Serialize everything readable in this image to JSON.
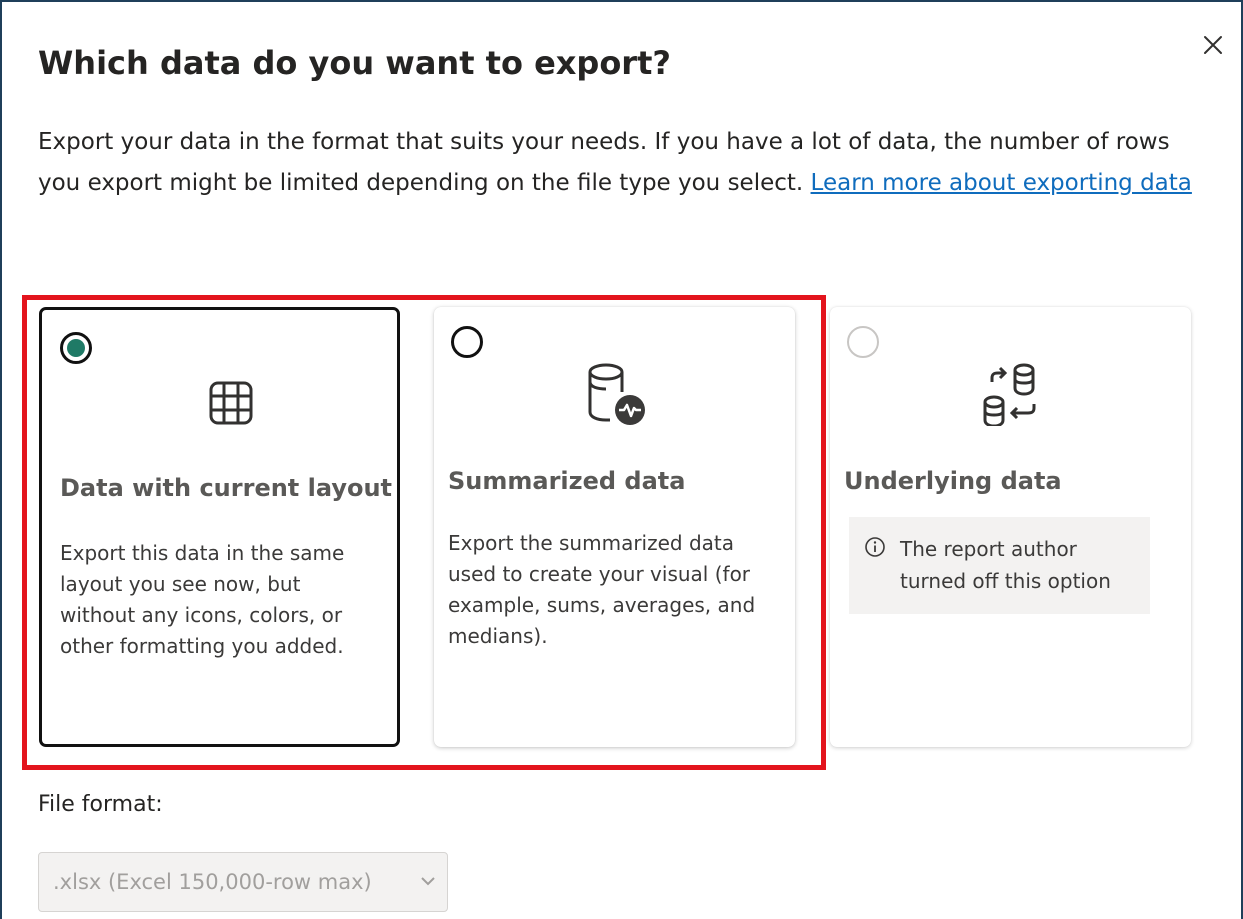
{
  "dialog": {
    "title": "Which data do you want to export?",
    "description": "Export your data in the format that suits your needs. If you have a lot of data, the number of rows you export might be limited depending on the file type you select.",
    "learn_more_link": "Learn more about exporting data",
    "close_icon": "close-icon"
  },
  "options": [
    {
      "title": "Data with current layout",
      "description": "Export this data in the same layout you see now, but without any icons, colors, or other formatting you added.",
      "selected": true,
      "disabled": false,
      "icon": "table-grid-icon"
    },
    {
      "title": "Summarized data",
      "description": "Export the summarized data used to create your visual (for example, sums, averages, and medians).",
      "selected": false,
      "disabled": false,
      "icon": "database-pulse-icon"
    },
    {
      "title": "Underlying data",
      "info": "The report author turned off this option",
      "selected": false,
      "disabled": true,
      "icon": "database-transfer-icon"
    }
  ],
  "file_format": {
    "label": "File format:",
    "value": ".xlsx (Excel 150,000-row max)",
    "disabled": true
  },
  "colors": {
    "selected_radio": "#1f7a66",
    "highlight": "#e3141d",
    "link": "#0f6cbd"
  }
}
